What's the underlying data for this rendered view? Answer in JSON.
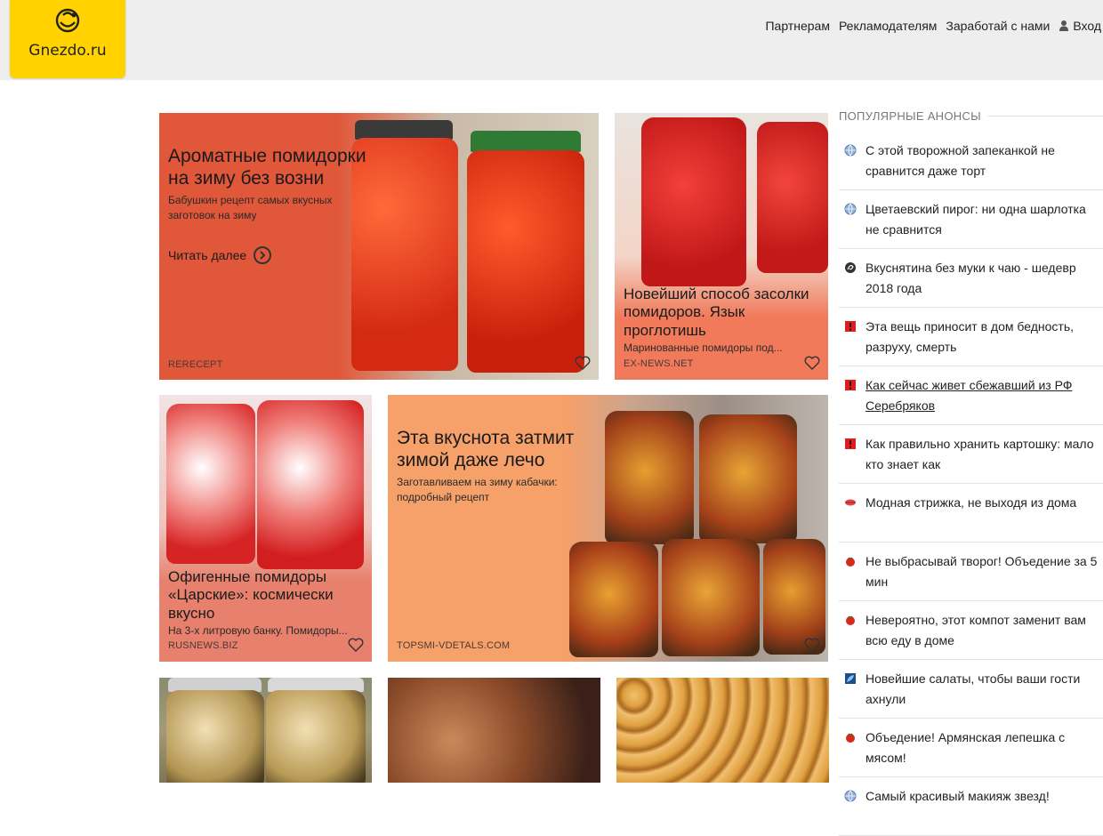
{
  "header": {
    "logo_text": "Gnezdo.ru",
    "nav": [
      {
        "label": "Партнерам"
      },
      {
        "label": "Рекламодателям"
      },
      {
        "label": "Заработай с нами"
      },
      {
        "label": "Вход"
      }
    ]
  },
  "cards": [
    {
      "title": "Ароматные помидорки на зиму без возни",
      "description": "Бабушкин рецепт самых вкусных заготовок на зиму",
      "read_more": "Читать далее",
      "source": "RERECEPT",
      "bg_color": "#e0573a"
    },
    {
      "title": "Новейший способ засолки помидоров. Язык проглотишь",
      "description": "Маринованные помидоры под...",
      "source": "EX-NEWS.NET",
      "bg_color": "#f07a5a"
    },
    {
      "title": "Офигенные помидоры «Царские»: космически вкусно",
      "description": "На 3-х литровую банку. Помидоры...",
      "source": "RUSNEWS.BIZ",
      "bg_color": "#e7806c"
    },
    {
      "title": "Эта вкуснота затмит зимой даже лечо",
      "description": "Заготавливаем на зиму кабачки: подробный рецепт",
      "source": "TOPSMI-VDETALS.COM",
      "bg_color": "#f6a06a"
    }
  ],
  "sidebar": {
    "heading": "ПОПУЛЯРНЫЕ АНОНСЫ",
    "items": [
      {
        "text": "С этой творожной запеканкой не сравнится даже торт",
        "icon": "globe-icon"
      },
      {
        "text": "Цветаевский пирог: ни одна шарлотка не сравнится",
        "icon": "globe-icon"
      },
      {
        "text": "Вкуснятина без муки к чаю - шедевр 2018 года",
        "icon": "swirl-icon"
      },
      {
        "text": "Эта вещь приносит в дом бедность, разруху, смерть",
        "icon": "exclamation-icon"
      },
      {
        "text": "Как сейчас живет сбежавший из РФ Серебряков",
        "icon": "exclamation-icon"
      },
      {
        "text": "Как правильно хранить картошку: мало кто знает как",
        "icon": "exclamation-icon"
      },
      {
        "text": "Модная стрижка, не выходя из дома",
        "icon": "lips-icon"
      },
      {
        "text": "Не выбрасывай творог! Объедение за 5 мин",
        "icon": "tomato-icon"
      },
      {
        "text": "Невероятно, этот компот заменит вам всю еду в доме",
        "icon": "tomato-icon"
      },
      {
        "text": "Новейшие салаты, чтобы ваши гости ахнули",
        "icon": "leaf-icon"
      },
      {
        "text": "Объедение! Армянская лепешка с мясом!",
        "icon": "tomato-icon"
      },
      {
        "text": "Самый красивый макияж звезд!",
        "icon": "globe-icon"
      }
    ]
  }
}
